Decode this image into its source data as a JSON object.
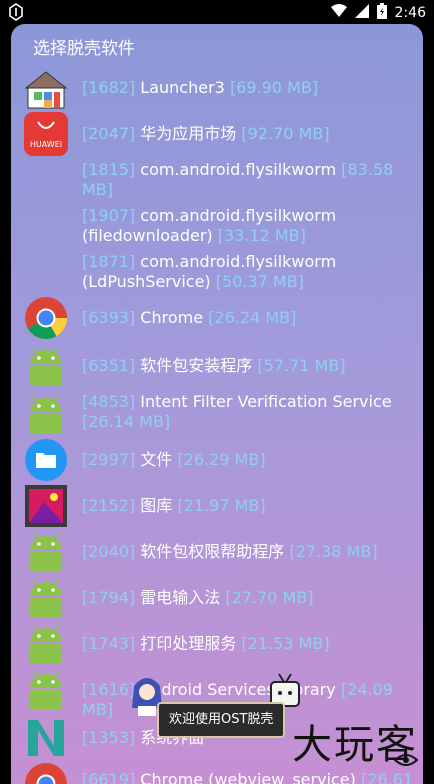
{
  "status": {
    "time": "2:46"
  },
  "dialog": {
    "title": "选择脱壳软件",
    "rows": [
      {
        "pid": "[1682]",
        "name": "Launcher3",
        "size": "[69.90 MB]",
        "icon": "home-icon"
      },
      {
        "pid": "[2047]",
        "name": "华为应用市场",
        "size": "[92.70 MB]",
        "icon": "huawei-appgallery-icon",
        "icon_label": "HUAWEI"
      },
      {
        "pid": "[1815]",
        "name": "com.android.flysilkworm",
        "size": "[83.58 MB]",
        "icon": "none"
      },
      {
        "pid": "[1907]",
        "name": "com.android.flysilkworm (filedownloader)",
        "size": "[33.12 MB]",
        "icon": "none"
      },
      {
        "pid": "[1871]",
        "name": "com.android.flysilkworm (LdPushService)",
        "size": "[50.37 MB]",
        "icon": "none"
      },
      {
        "pid": "[6393]",
        "name": "Chrome",
        "size": "[26.24 MB]",
        "icon": "chrome-icon"
      },
      {
        "pid": "[6351]",
        "name": "软件包安装程序",
        "size": "[57.71 MB]",
        "icon": "android-icon"
      },
      {
        "pid": "[4853]",
        "name": "Intent Filter Verification Service",
        "size": "[26.14 MB]",
        "icon": "android-icon"
      },
      {
        "pid": "[2997]",
        "name": "文件",
        "size": "[26.29 MB]",
        "icon": "files-icon"
      },
      {
        "pid": "[2152]",
        "name": "图库",
        "size": "[21.97 MB]",
        "icon": "gallery-icon"
      },
      {
        "pid": "[2040]",
        "name": "软件包权限帮助程序",
        "size": "[27.38 MB]",
        "icon": "android-icon"
      },
      {
        "pid": "[1794]",
        "name": "雷电输入法",
        "size": "[27.70 MB]",
        "icon": "android-icon"
      },
      {
        "pid": "[1743]",
        "name": "打印处理服务",
        "size": "[21.53 MB]",
        "icon": "android-icon"
      },
      {
        "pid": "[1616]",
        "name": "Android Services Library",
        "size": "[24.09 MB]",
        "icon": "android-icon"
      },
      {
        "pid": "[1353]",
        "name": "系统界面",
        "size": "",
        "icon": "nexus-icon"
      },
      {
        "pid": "[6619]",
        "name": "Chrome (webview_service)",
        "size": "[26.61",
        "icon": "chrome-icon"
      }
    ]
  },
  "toast": {
    "text": "欢迎使用OST脱壳"
  },
  "watermark": {
    "text": "大玩客"
  },
  "colors": {
    "pid": "#8fd0f2",
    "text": "#ffffff",
    "android_green": "#8bc34a"
  }
}
